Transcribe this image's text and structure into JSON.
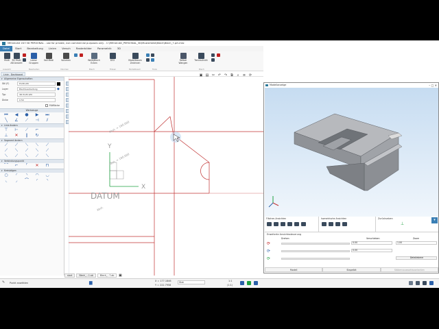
{
  "app": {
    "title": "MEGACAD 2D+3D PERSONAL - use for private, non commercial purposes only - C:\\MEGACAD_PERSONAL_3D\\Musterteile\\Blech\\Blech_7.prt.mkz"
  },
  "menu": [
    "Datei",
    "Start",
    "Bearbeitung",
    "Linien",
    "Versch",
    "Rasterbilder",
    "Parametrik",
    "3D"
  ],
  "ribbon": {
    "buttons": [
      {
        "label": "Multi",
        "color": "#3a4a5c"
      },
      {
        "label": "3D Multi\nAB Ansicht",
        "color": "#3a4a5c"
      },
      {
        "label": "Leese\nGruppen",
        "color": "#c02020"
      },
      {
        "label": "Voll\nMedi",
        "color": "#2a5fa8"
      },
      {
        "label": "Volumen",
        "color": "#4a4a4a"
      },
      {
        "label": "Weiß/Blech\nEcken",
        "color": "#5a6c80"
      },
      {
        "label": "D32",
        "color": "#3a4a5c"
      },
      {
        "label": "Modellbaum\nZeichnen",
        "color": "#3a4a5c"
      },
      {
        "label": "Faltbei\nWangen",
        "color": "#4a5668"
      },
      {
        "label": "Trennschnitt",
        "color": "#3a4a5c"
      }
    ],
    "groups": [
      "Auswahl",
      "Bearbeiten",
      "Volumen",
      "Blech",
      "Fräsen",
      "Modellbaum",
      "Tools",
      "Blech"
    ]
  },
  "left_tab": "Linie - Dashboard",
  "props_header": "Allgemeine Eigenschaften",
  "props": [
    {
      "label": "Stil (F)",
      "value": "Profil LP0"
    },
    {
      "label": "Layer",
      "value": "Blechbearbeitung"
    },
    {
      "label": "Typ",
      "value": "3D Profil LP0"
    },
    {
      "label": "Dicke",
      "value": "0.50"
    }
  ],
  "fullfill_label": "Füllfläche",
  "sections": [
    {
      "title": "Werkzeuge"
    },
    {
      "title": "Linie ändern"
    },
    {
      "title": "Segment ändern"
    },
    {
      "title": "Verbindungspunkt"
    },
    {
      "title": "Kreisbögen"
    }
  ],
  "drawing": {
    "datum_label": "DATUM",
    "axis_x": "X",
    "axis_y": "Y",
    "dim_labels": [
      "Abst. = 180.000",
      "Abst. = 180.000",
      "Abst."
    ]
  },
  "doc_tabs": [
    "start",
    "Blech_...1.ab",
    "Blech_...7.ab"
  ],
  "status": {
    "hint": "Punkt anwählen",
    "coord_x": "X = 177.1846",
    "coord_y": "Y = 222.7958",
    "snap": "Stat",
    "scale_top": "1:1",
    "scale_bottom": "(1:1)"
  },
  "win3d": {
    "title": "Modellanzeige",
    "sections": [
      {
        "title": "Flächen-Ansichten"
      },
      {
        "title": "Isometrische Ansichten"
      },
      {
        "title": "Zurücksetzen"
      }
    ],
    "steer_header": "Erweiterte Ansichtssteuerung",
    "col_drehen": "Drehen",
    "col_verschieben": "Verschieben",
    "col_zoom": "Zoom",
    "rot_fields": [
      "0.00",
      "0.00"
    ],
    "zoom_field": "1.00",
    "detail_button": "Detailebene",
    "bottom_buttons": [
      "Modell",
      "Stapelbit",
      "Stöbensauswahlscontanten"
    ]
  },
  "colors": {
    "accent": "#3a7fb5",
    "drawing_line": "#c03030",
    "datum_axis": "#1ea040"
  }
}
